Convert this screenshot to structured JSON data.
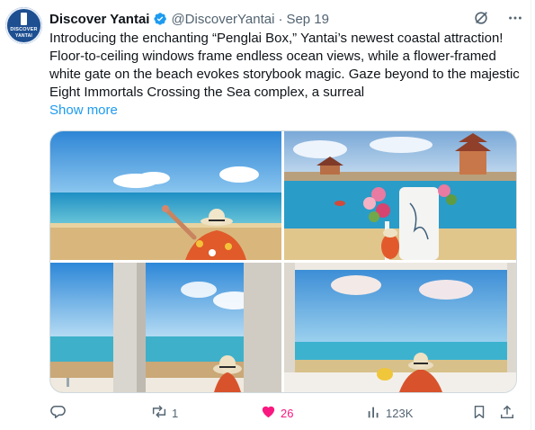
{
  "account": {
    "avatar_text_line1": "DISCOVER",
    "avatar_text_line2": "YANTAI",
    "display_name": "Discover Yantai",
    "handle": "@DiscoverYantai",
    "separator": "·",
    "date": "Sep 19"
  },
  "post": {
    "text": "Introducing the enchanting “Penglai Box,” Yantai’s newest coastal attraction! Floor-to-ceiling windows frame endless ocean views, while a flower-framed white gate on the beach evokes storybook magic. Gaze beyond to the majestic Eight Immortals Crossing the Sea complex, a surreal",
    "show_more": "Show more"
  },
  "media": {
    "images": [
      {
        "icon": "photo-beach-woman-waving"
      },
      {
        "icon": "photo-white-gate-flowers-pavilion"
      },
      {
        "icon": "photo-window-sea-view-left"
      },
      {
        "icon": "photo-window-sea-view-right"
      }
    ]
  },
  "actions": {
    "reply_count": "",
    "repost_count": "1",
    "like_count": "26",
    "views_count": "123K"
  },
  "colors": {
    "accent": "#1d9bf0",
    "like": "#f91880",
    "secondary_text": "#536471",
    "verified": "#1d9bf0"
  }
}
